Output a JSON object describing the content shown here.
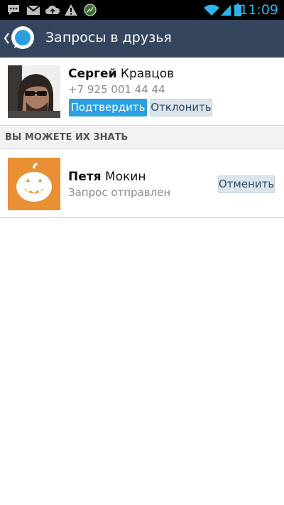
{
  "status_bar": {
    "time": "11:09",
    "icons": [
      "message-icon",
      "mail-icon",
      "cloud-upload-icon",
      "warning-icon",
      "app-icon",
      "wifi-icon",
      "signal-icon",
      "battery-icon"
    ]
  },
  "action_bar": {
    "title": "Запросы в друзья",
    "logo": "app-logo-icon",
    "back": "back-chevron-icon",
    "bg_color": "#35455d"
  },
  "friend_request": {
    "first_name": "Сергей",
    "last_name": "Кравцов",
    "phone": "+7 925 001 44 44",
    "confirm_label": "Подтвердить",
    "reject_label": "Отклонить"
  },
  "section": {
    "title": "ВЫ МОЖЕТЕ ИХ ЗНАТЬ"
  },
  "suggestion": {
    "first_name": "Петя",
    "last_name": "Мокин",
    "status": "Запрос отправлен",
    "cancel_label": "Отменить",
    "avatar_icon": "pumpkin-icon"
  },
  "colors": {
    "accent": "#2b9fe0",
    "time": "#2fb4ea",
    "pumpkin_bg": "#e98f35"
  }
}
